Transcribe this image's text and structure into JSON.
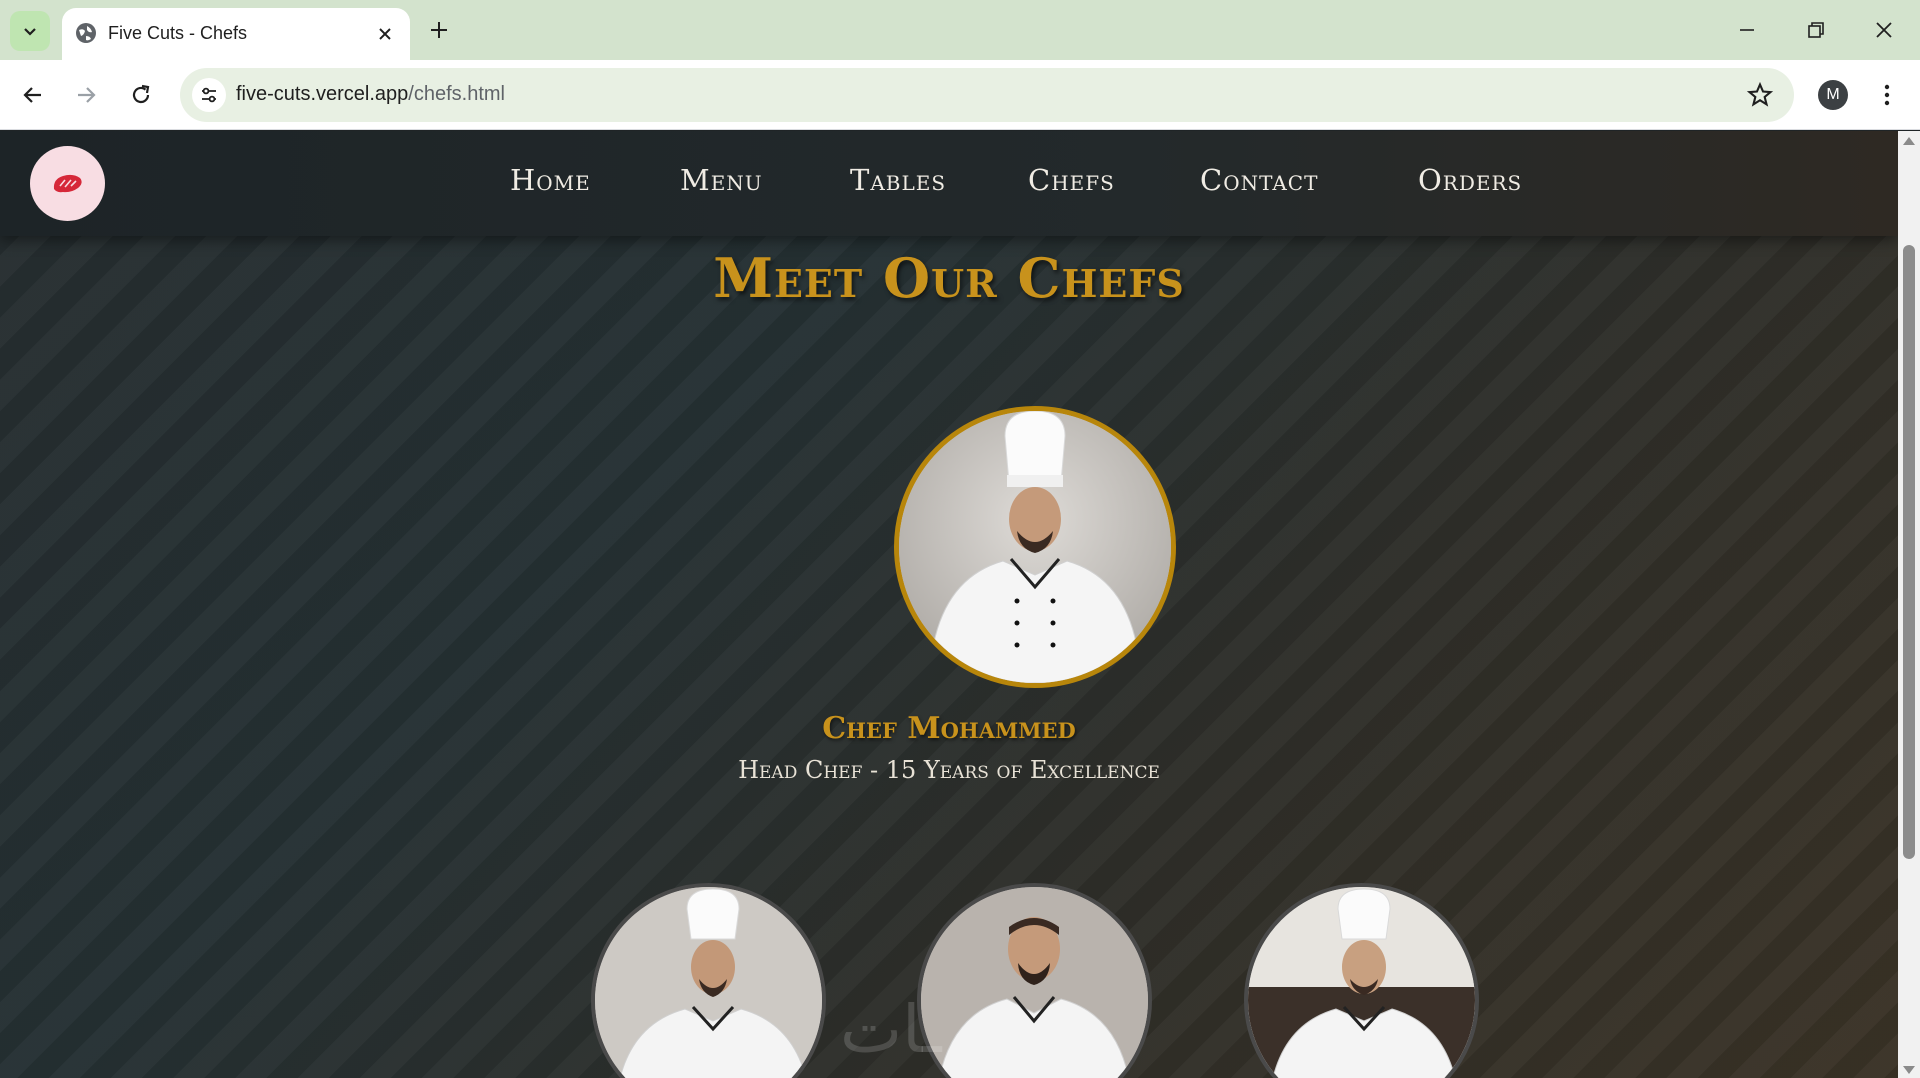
{
  "browser": {
    "tab_title": "Five Cuts - Chefs",
    "url_host": "five-cuts.vercel.app",
    "url_path": "/chefs.html",
    "profile_initial": "M"
  },
  "nav": {
    "items": [
      "Home",
      "Menu",
      "Tables",
      "Chefs",
      "Contact",
      "Orders"
    ]
  },
  "page": {
    "title": "Meet Our Chefs",
    "head_chef": {
      "name": "Chef Mohammed",
      "role": "Head Chef - 15 Years of Excellence"
    },
    "watermark": "ـات"
  },
  "colors": {
    "gold": "#c8921c",
    "logo_bg": "#f8dde3",
    "logo_accent": "#d62839"
  }
}
